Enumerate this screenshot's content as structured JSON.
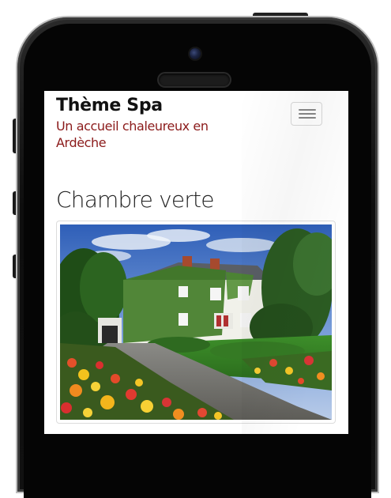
{
  "site": {
    "brand_title": "Thème Spa",
    "tagline": "Un accueil chaleureux en Ardèche"
  },
  "navbar": {
    "toggle_icon": "hamburger-menu-icon"
  },
  "main": {
    "page_title": "Chambre verte",
    "photo": {
      "subject": "ivy-covered white country house with flower garden"
    }
  },
  "colors": {
    "tagline": "#8b1a1a",
    "phone_body": "#111111",
    "screen_bg": "#ffffff"
  }
}
